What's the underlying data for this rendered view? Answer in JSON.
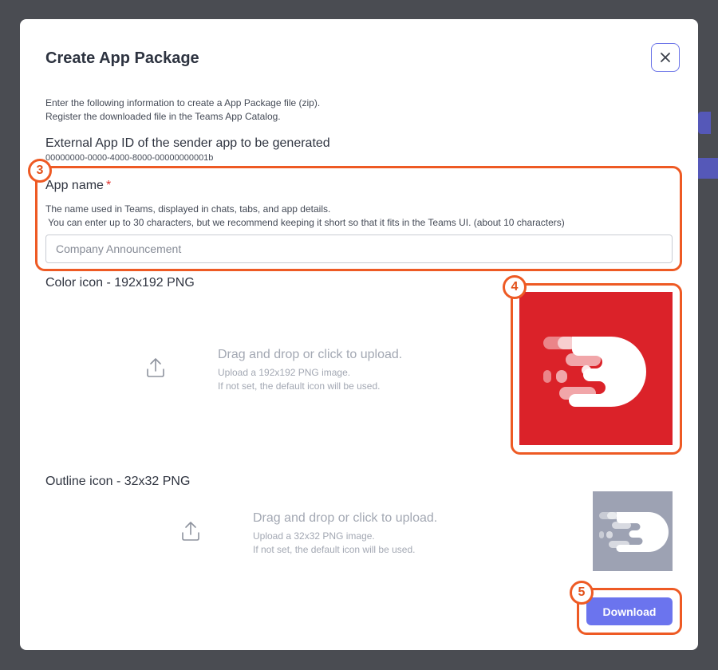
{
  "modal": {
    "title": "Create App Package",
    "intro_line1": "Enter the following information to create a App Package file (zip).",
    "intro_line2": "Register the downloaded file in the Teams App Catalog.",
    "external_id_label": "External App ID of the sender app to be generated",
    "external_id_value": "00000000-0000-4000-8000-00000000001b",
    "app_name": {
      "label": "App name",
      "required_mark": "*",
      "desc_line1": "The name used in Teams, displayed in chats, tabs, and app details.",
      "desc_line2": " You can enter up to 30 characters, but we recommend keeping it short so that it fits in the Teams UI. (about 10 characters)",
      "placeholder": "Company Announcement",
      "value": ""
    },
    "color_icon": {
      "label": "Color icon - 192x192 PNG",
      "upload_main": "Drag and drop or click to upload.",
      "upload_sub1": "Upload a 192x192 PNG image.",
      "upload_sub2": "If not set, the default icon will be used.",
      "preview_bg": "#db2229"
    },
    "outline_icon": {
      "label": "Outline icon - 32x32 PNG",
      "upload_main": "Drag and drop or click to upload.",
      "upload_sub1": "Upload a 32x32 PNG image.",
      "upload_sub2": "If not set, the default icon will be used.",
      "preview_bg": "#9da2b3"
    },
    "download_label": "Download"
  },
  "callouts": {
    "c3": "3",
    "c4": "4",
    "c5": "5",
    "color": "#ee5a24"
  },
  "icons": [
    "close-icon",
    "upload-icon",
    "app-logo-icon"
  ]
}
